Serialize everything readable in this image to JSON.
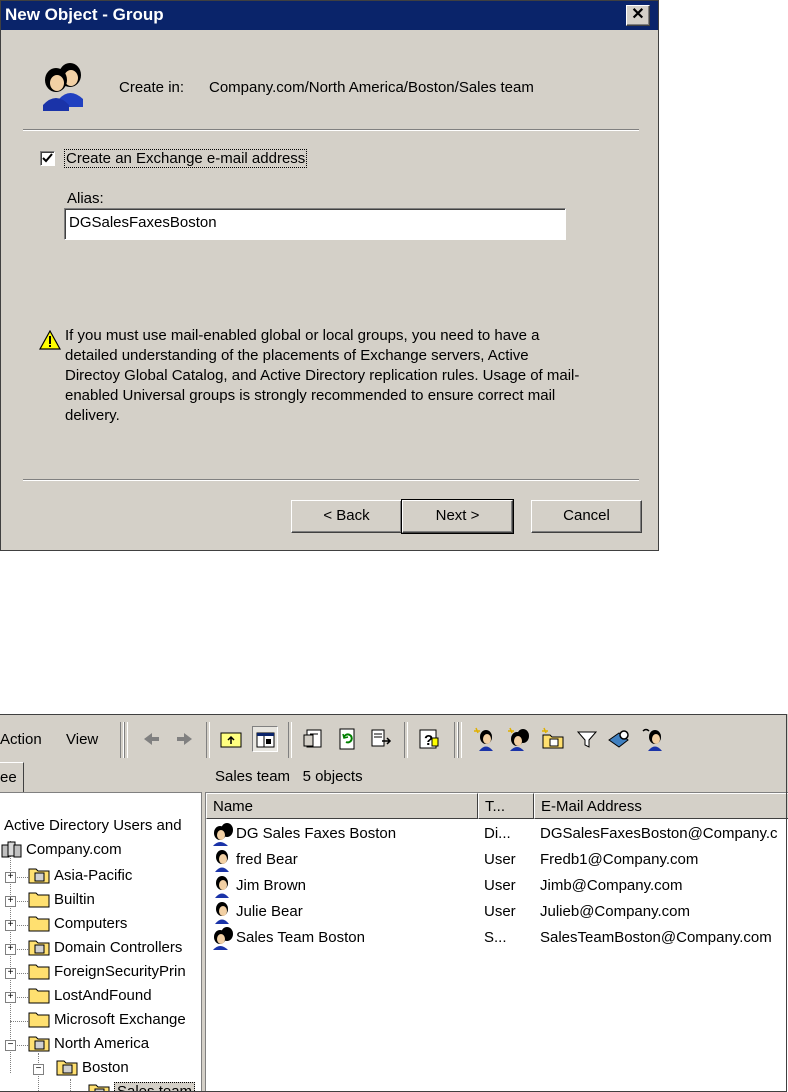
{
  "dialog": {
    "title": "New Object - Group",
    "close_glyph": "✕",
    "create_in_label": "Create in:",
    "create_in_path": "Company.com/North America/Boston/Sales team",
    "checkbox_label": "Create an Exchange e-mail address",
    "checkbox_checked": true,
    "alias_label": "Alias:",
    "alias_value": "DGSalesFaxesBoston",
    "warning_text": "If you must use mail-enabled global or local groups, you need to have a detailed understanding of the placements of Exchange servers, Active Directoy Global Catalog, and Active Directory replication rules. Usage of mail-enabled Universal groups is strongly recommended to ensure correct mail delivery.",
    "buttons": {
      "back": "< Back",
      "next": "Next >",
      "cancel": "Cancel"
    },
    "icons": {
      "group": "group-icon",
      "warning": "warning-icon"
    }
  },
  "mmc": {
    "menu": {
      "action": "Action",
      "view": "View"
    },
    "tab_label": "ee",
    "header_title": "Sales team",
    "header_count": "5 objects",
    "toolbar_icons": [
      "back-arrow-icon",
      "forward-arrow-icon",
      "up-folder-icon",
      "show-hide-tree-icon",
      "properties-icon",
      "refresh-icon",
      "export-list-icon",
      "help-icon",
      "new-user-icon",
      "new-group-icon",
      "new-ou-icon",
      "filter-icon",
      "find-icon",
      "add-to-group-icon"
    ],
    "tree": [
      {
        "label": "Active Directory Users and",
        "icon": "ad-root-icon"
      },
      {
        "label": "Company.com",
        "icon": "domain-icon"
      },
      {
        "label": "Asia-Pacific",
        "icon": "ou-icon"
      },
      {
        "label": "Builtin",
        "icon": "folder-icon"
      },
      {
        "label": "Computers",
        "icon": "folder-icon"
      },
      {
        "label": "Domain Controllers",
        "icon": "ou-icon"
      },
      {
        "label": "ForeignSecurityPrin",
        "icon": "folder-icon"
      },
      {
        "label": "LostAndFound",
        "icon": "folder-icon"
      },
      {
        "label": "Microsoft Exchange",
        "icon": "folder-icon"
      },
      {
        "label": "North America",
        "icon": "ou-icon"
      },
      {
        "label": "Boston",
        "icon": "ou-icon"
      },
      {
        "label": "Sales team",
        "icon": "ou-icon"
      }
    ],
    "columns": [
      "Name",
      "T...",
      "E-Mail Address"
    ],
    "rows": [
      {
        "name": "DG Sales Faxes Boston",
        "type": "Di...",
        "email": "DGSalesFaxesBoston@Company.c",
        "icon": "group-icon"
      },
      {
        "name": "fred Bear",
        "type": "User",
        "email": "Fredb1@Company.com",
        "icon": "user-icon"
      },
      {
        "name": "Jim Brown",
        "type": "User",
        "email": "Jimb@Company.com",
        "icon": "user-icon"
      },
      {
        "name": "Julie Bear",
        "type": "User",
        "email": "Julieb@Company.com",
        "icon": "user-icon"
      },
      {
        "name": "Sales Team Boston",
        "type": "S...",
        "email": "SalesTeamBoston@Company.com",
        "icon": "group-icon"
      }
    ]
  }
}
